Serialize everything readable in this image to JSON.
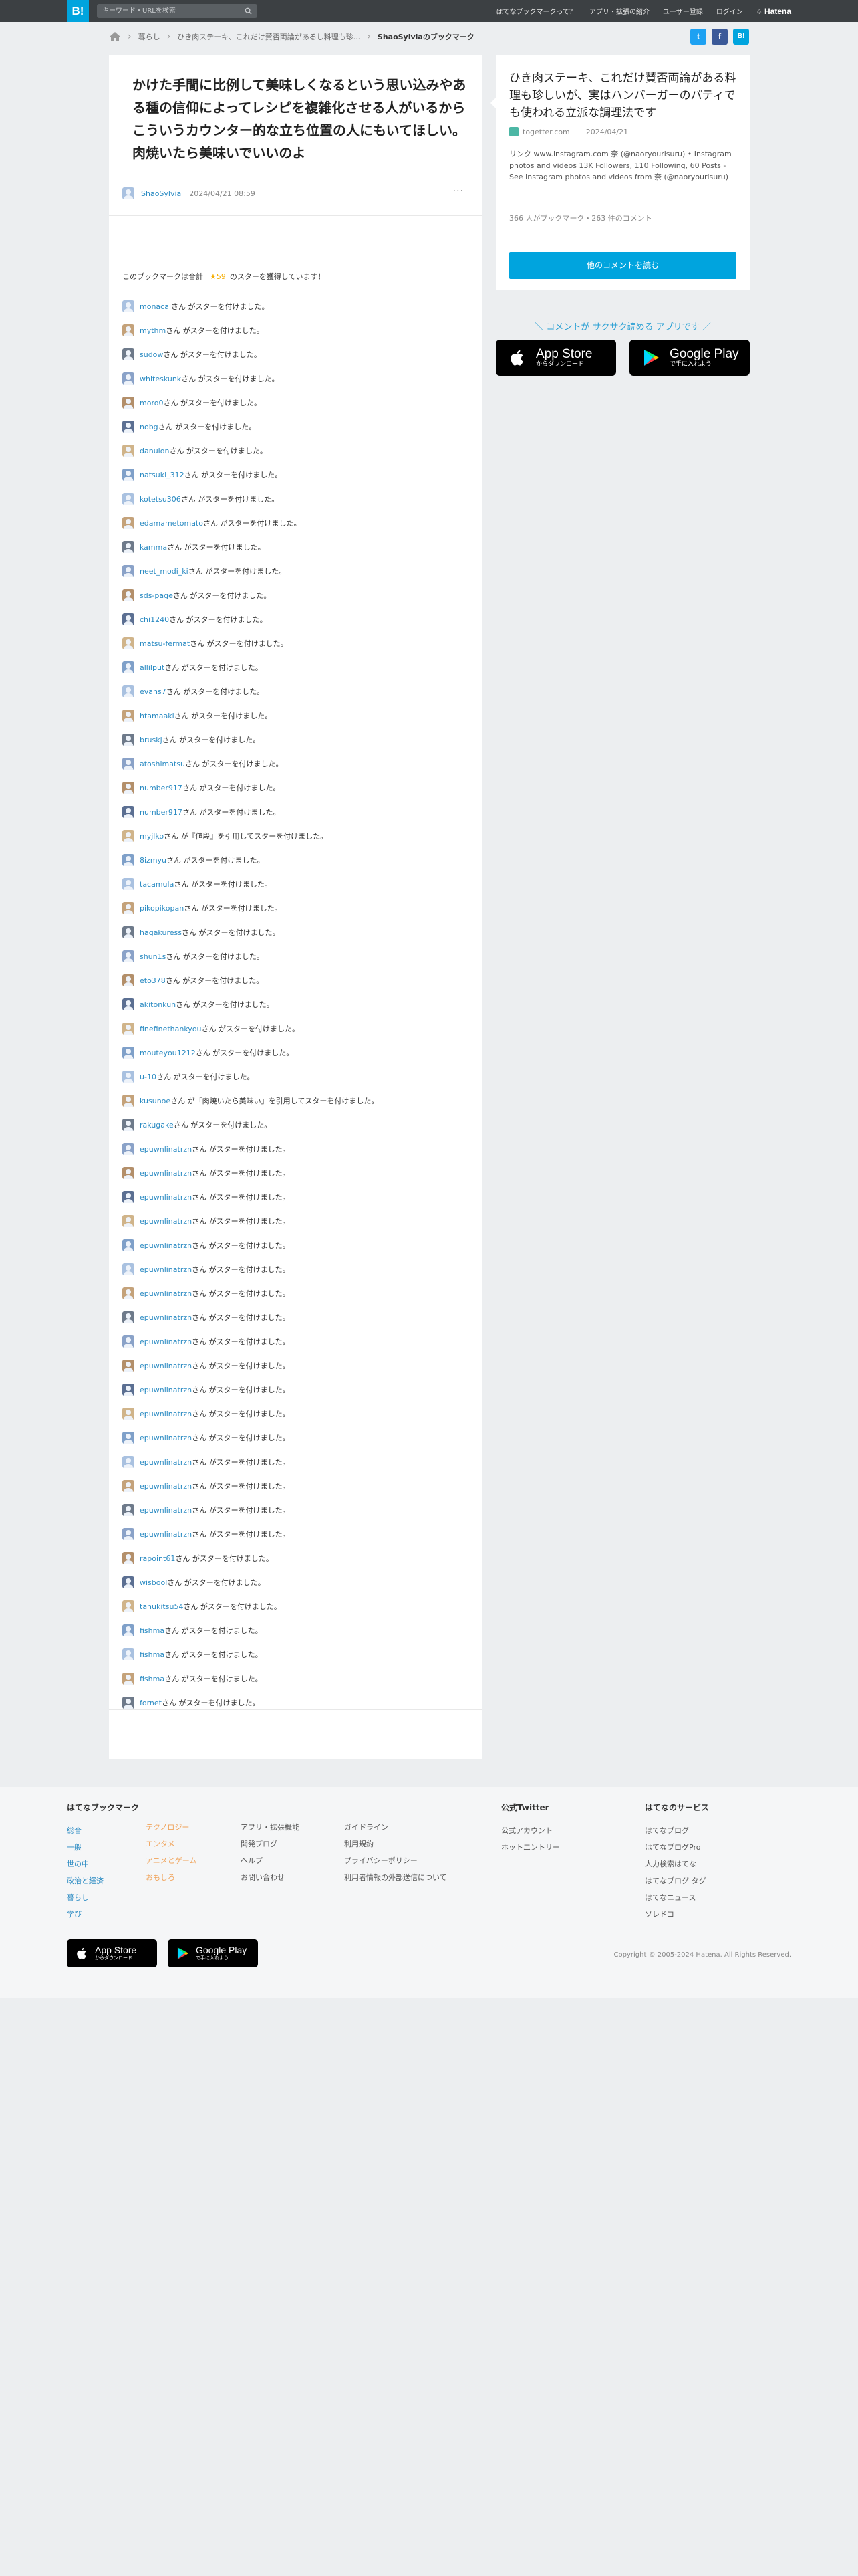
{
  "header": {
    "logo": "B!",
    "search_placeholder": "キーワード・URLを検索",
    "links": [
      "はてなブックマークって？",
      "アプリ・拡張の紹介",
      "ユーザー登録",
      "ログイン"
    ],
    "brand": "Hatena"
  },
  "breadcrumb": {
    "items": [
      "暮らし",
      "ひき肉ステーキ、これだけ賛否両論があるし料理も珍..."
    ],
    "current": "ShaoSylviaのブックマーク"
  },
  "share": {
    "twitter": "t",
    "facebook": "f",
    "hatena": "B!"
  },
  "entry": {
    "comment": "かけた手間に比例して美味しくなるという思い込みやある種の信仰によってレシピを複雑化させる人がいるからこういうカウンター的な立ち位置の人にもいてほしい。肉焼いたら美味いでいいのよ",
    "user": "ShaoSylvia",
    "date": "2024/04/21 08:59",
    "more": "···"
  },
  "stars": {
    "summary_prefix": "このブックマークは合計",
    "count": "★59",
    "summary_suffix": "のスターを獲得しています！",
    "suffix": "さん がスターを付けました。",
    "items": [
      {
        "user": "monacal"
      },
      {
        "user": "mythm"
      },
      {
        "user": "sudow"
      },
      {
        "user": "whiteskunk"
      },
      {
        "user": "moro0"
      },
      {
        "user": "nobg"
      },
      {
        "user": "danuion"
      },
      {
        "user": "natsuki_312"
      },
      {
        "user": "kotetsu306"
      },
      {
        "user": "edamametomato"
      },
      {
        "user": "kamma"
      },
      {
        "user": "neet_modi_ki"
      },
      {
        "user": "sds-page"
      },
      {
        "user": "chi1240"
      },
      {
        "user": "matsu-fermat"
      },
      {
        "user": "allilput"
      },
      {
        "user": "evans7"
      },
      {
        "user": "htamaaki"
      },
      {
        "user": "bruskj"
      },
      {
        "user": "atoshimatsu"
      },
      {
        "user": "number917"
      },
      {
        "user": "number917"
      },
      {
        "user": "myjlko",
        "quote": "『値段』を引用してスターを付けました。"
      },
      {
        "user": "8izmyu"
      },
      {
        "user": "tacamula"
      },
      {
        "user": "pikopikopan"
      },
      {
        "user": "hagakuress"
      },
      {
        "user": "shun1s"
      },
      {
        "user": "eto378"
      },
      {
        "user": "akitonkun"
      },
      {
        "user": "finefinethankyou"
      },
      {
        "user": "mouteyou1212"
      },
      {
        "user": "u-10"
      },
      {
        "user": "kusunoe",
        "quote": "「肉焼いたら美味い」を引用してスターを付けました。"
      },
      {
        "user": "rakugake"
      },
      {
        "user": "epuwnlinatrzn"
      },
      {
        "user": "epuwnlinatrzn"
      },
      {
        "user": "epuwnlinatrzn"
      },
      {
        "user": "epuwnlinatrzn"
      },
      {
        "user": "epuwnlinatrzn"
      },
      {
        "user": "epuwnlinatrzn"
      },
      {
        "user": "epuwnlinatrzn"
      },
      {
        "user": "epuwnlinatrzn"
      },
      {
        "user": "epuwnlinatrzn"
      },
      {
        "user": "epuwnlinatrzn"
      },
      {
        "user": "epuwnlinatrzn"
      },
      {
        "user": "epuwnlinatrzn"
      },
      {
        "user": "epuwnlinatrzn"
      },
      {
        "user": "epuwnlinatrzn"
      },
      {
        "user": "epuwnlinatrzn"
      },
      {
        "user": "epuwnlinatrzn"
      },
      {
        "user": "epuwnlinatrzn"
      },
      {
        "user": "rapoint61"
      },
      {
        "user": "wisbool"
      },
      {
        "user": "tanukitsu54"
      },
      {
        "user": "fishma"
      },
      {
        "user": "fishma"
      },
      {
        "user": "fishma"
      },
      {
        "user": "fornet"
      }
    ]
  },
  "side": {
    "title": "ひき肉ステーキ、これだけ賛否両論がある料理も珍しいが、実はハンバーガーのパティでも使われる立派な調理法です",
    "site": "togetter.com",
    "date": "2024/04/21",
    "desc": "リンク www.instagram.com 奈 (@naoryourisuru) • Instagram photos and videos 13K Followers, 110 Following, 60 Posts - See Instagram photos and videos from 奈 (@naoryourisuru)",
    "counts": "366 人がブックマーク・263 件のコメント",
    "button": "他のコメントを読む"
  },
  "apps": {
    "caption": "＼ コメントが サクサク読める アプリです ／",
    "appstore_small": "からダウンロード",
    "appstore_big": "App Store",
    "gplay_small": "で手に入れよう",
    "gplay_big": "Google Play"
  },
  "footer": {
    "col1_title": "はてなブックマーク",
    "col1a": [
      "総合",
      "一般",
      "世の中",
      "政治と経済",
      "暮らし",
      "学び"
    ],
    "col1b": [
      "テクノロジー",
      "エンタメ",
      "アニメとゲーム",
      "おもしろ"
    ],
    "col2": [
      "アプリ・拡張機能",
      "開発ブログ",
      "ヘルプ",
      "お問い合わせ"
    ],
    "col3": [
      "ガイドライン",
      "利用規約",
      "プライバシーポリシー",
      "利用者情報の外部送信について"
    ],
    "col4_title": "公式Twitter",
    "col4": [
      "公式アカウント",
      "ホットエントリー"
    ],
    "col5_title": "はてなのサービス",
    "col5": [
      "はてなブログ",
      "はてなブログPro",
      "人力検索はてな",
      "はてなブログ タグ",
      "はてなニュース",
      "ソレドコ"
    ],
    "copyright": "Copyright © 2005-2024 Hatena. All Rights Reserved."
  }
}
